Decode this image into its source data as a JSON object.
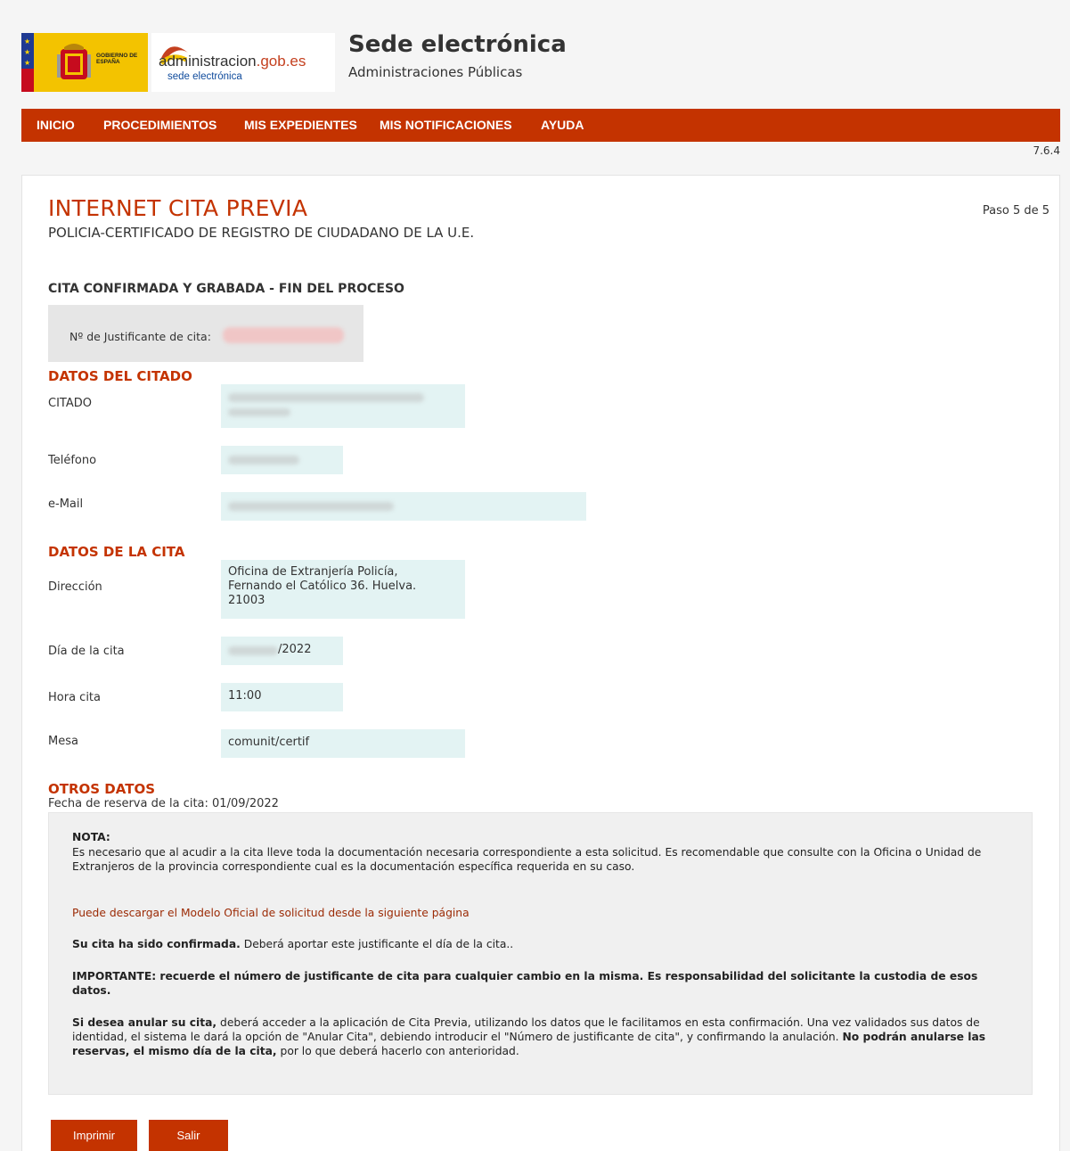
{
  "header": {
    "gov_logo_text": "GOBIERNO DE ESPAÑA",
    "admin_logo_main_a": "administracion",
    "admin_logo_main_b": ".gob.es",
    "admin_logo_sub": "sede electrónica",
    "site_title": "Sede electrónica",
    "site_subtitle": "Administraciones Públicas"
  },
  "nav": {
    "items": [
      "INICIO",
      "PROCEDIMIENTOS",
      "MIS EXPEDIENTES",
      "MIS NOTIFICACIONES",
      "AYUDA"
    ],
    "version": "7.6.4"
  },
  "page": {
    "title": "INTERNET CITA PREVIA",
    "subtitle": "POLICIA-CERTIFICADO DE REGISTRO DE CIUDADANO DE LA U.E.",
    "step": "Paso 5 de 5",
    "confirm_heading": "CITA CONFIRMADA Y GRABADA - FIN DEL PROCESO",
    "justificante_label": "Nº de Justificante de cita:"
  },
  "citado": {
    "heading": "DATOS DEL CITADO",
    "citado_label": "CITADO",
    "telefono_label": "Teléfono",
    "email_label": "e-Mail"
  },
  "cita": {
    "heading": "DATOS DE LA CITA",
    "direccion_label": "Dirección",
    "direccion_line1": "Oficina de Extranjería Policía,",
    "direccion_line2": "Fernando el Católico 36. Huelva.",
    "direccion_line3": "21003",
    "dia_label": "Día de la cita",
    "dia_value": "/2022",
    "hora_label": "Hora cita",
    "hora_value": "11:00",
    "mesa_label": "Mesa",
    "mesa_value": "comunit/certif"
  },
  "otros": {
    "heading": "OTROS DATOS",
    "reserve": "Fecha de reserva de la cita: 01/09/2022"
  },
  "note": {
    "title": "NOTA:",
    "p1": "Es necesario que al acudir a la cita lleve toda la documentación necesaria correspondiente a esta solicitud. Es recomendable que consulte con la Oficina o Unidad de Extranjeros de la provincia correspondiente cual es la documentación específica requerida en su caso.",
    "link": "Puede descargar el Modelo Oficial de solicitud desde la siguiente página",
    "p3_bold": "Su cita ha sido confirmada.",
    "p3_rest": " Deberá aportar este justificante el día de la cita..",
    "p4": "IMPORTANTE: recuerde el número de justificante de cita para cualquier cambio en la misma. Es responsabilidad del solicitante la custodia de esos datos.",
    "p5_bold1": "Si desea anular su cita,",
    "p5_mid": " deberá acceder a la aplicación de Cita Previa, utilizando los datos que le facilitamos en esta confirmación. Una vez validados sus datos de identidad, el sistema le dará la opción de \"Anular Cita\", debiendo introducir el \"Número de justificante de cita\", y confirmando la anulación. ",
    "p5_bold2": "No podrán anularse las reservas, el mismo día de la cita,",
    "p5_end": " por lo que deberá hacerlo con anterioridad."
  },
  "buttons": {
    "print": "Imprimir",
    "exit": "Salir"
  },
  "colors": {
    "accent": "#c43300",
    "field_bg": "#e3f3f3",
    "link": "#9b2a05"
  }
}
